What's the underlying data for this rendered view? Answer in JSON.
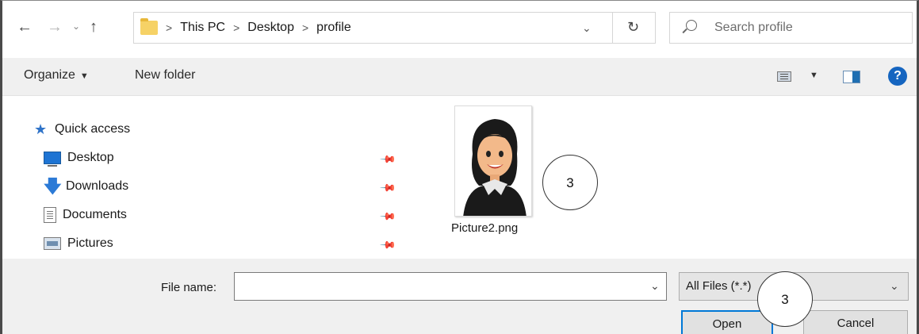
{
  "address_bar": {
    "breadcrumbs": [
      "This PC",
      "Desktop",
      "profile"
    ],
    "separator": ">",
    "search_placeholder": "Search profile"
  },
  "toolbar": {
    "organize_label": "Organize",
    "new_folder_label": "New folder"
  },
  "navigation_pane": {
    "items": [
      {
        "label": "Quick access",
        "icon": "star-icon",
        "pinned": false
      },
      {
        "label": "Desktop",
        "icon": "desktop-icon",
        "pinned": true
      },
      {
        "label": "Downloads",
        "icon": "download-icon",
        "pinned": true
      },
      {
        "label": "Documents",
        "icon": "documents-icon",
        "pinned": true
      },
      {
        "label": "Pictures",
        "icon": "pictures-icon",
        "pinned": true
      }
    ]
  },
  "files": [
    {
      "name": "Picture2.png"
    }
  ],
  "annotations": {
    "circle_1": "3",
    "circle_2": "3"
  },
  "footer": {
    "file_name_label": "File name:",
    "file_name_value": "",
    "filter_value": "All Files (*.*)",
    "open_label": "Open",
    "cancel_label": "Cancel"
  },
  "colors": {
    "accent": "#0078d7",
    "help_icon": "#1565c0",
    "folder": "#f6d266",
    "toolbar_bg": "#f0f0f0"
  }
}
